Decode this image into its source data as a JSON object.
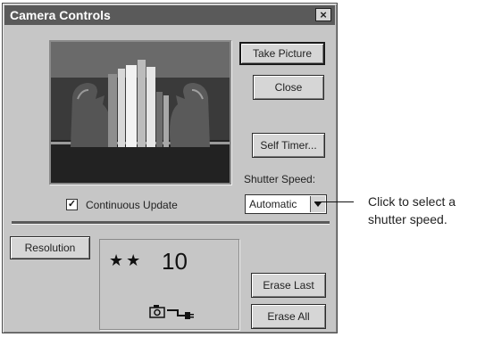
{
  "window": {
    "title": "Camera Controls",
    "close_glyph": "×"
  },
  "buttons": {
    "take_picture": "Take Picture",
    "close": "Close",
    "self_timer": "Self Timer...",
    "resolution": "Resolution",
    "erase_last": "Erase Last",
    "erase_all": "Erase All"
  },
  "shutter_speed": {
    "label": "Shutter Speed:",
    "selected": "Automatic"
  },
  "continuous_update": {
    "label": "Continuous Update",
    "checked": true,
    "check_glyph": "✓"
  },
  "status": {
    "stars": "★★",
    "count": "10"
  },
  "callout": {
    "line1": "Click to select a",
    "line2": "shutter speed."
  },
  "icons": [
    "close-icon",
    "camera-icon",
    "plug-icon",
    "dropdown-arrow-icon",
    "checkbox-check-icon"
  ]
}
